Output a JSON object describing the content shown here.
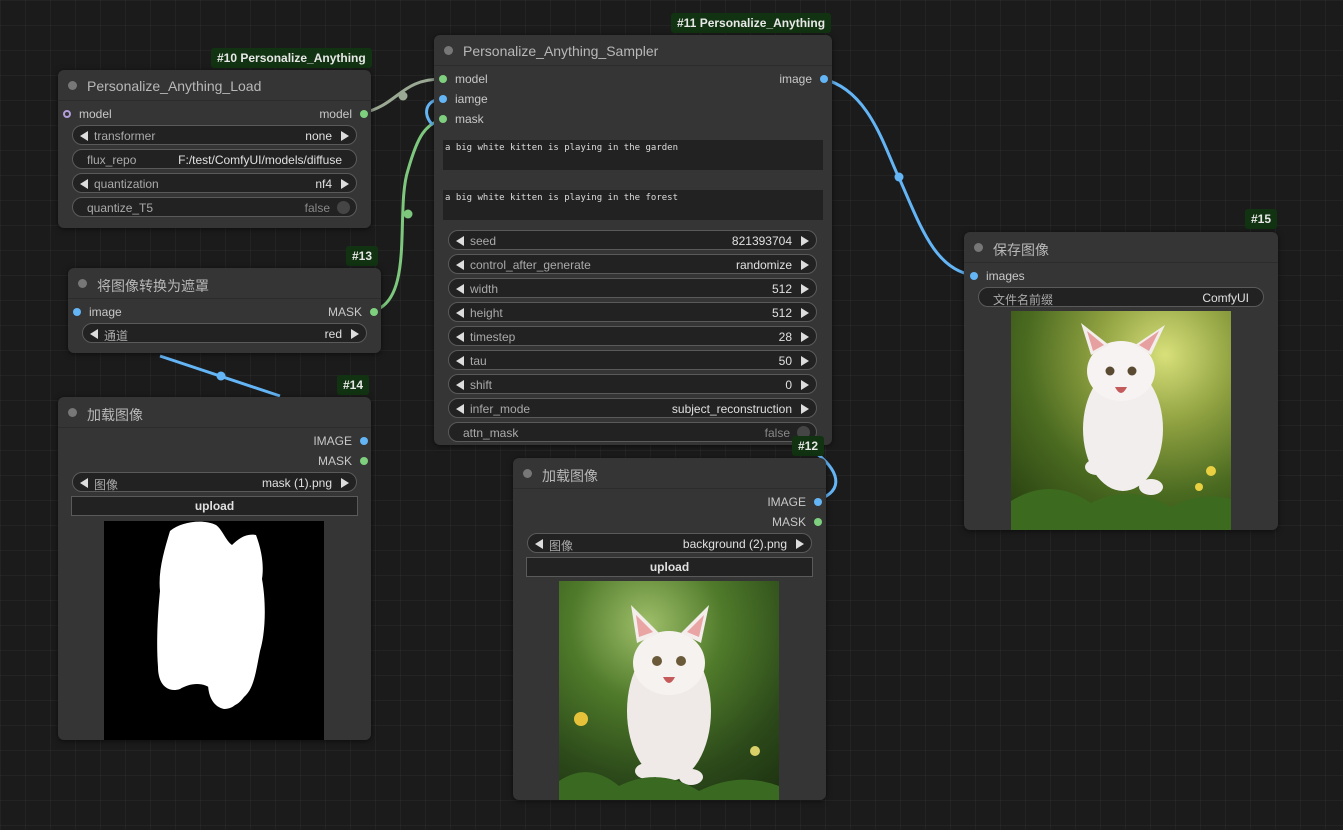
{
  "nodes": {
    "load": {
      "badge": "#10 Personalize_Anything",
      "title": "Personalize_Anything_Load",
      "input": "model",
      "output": "model",
      "widgets": [
        {
          "label": "transformer",
          "value": "none"
        },
        {
          "label": "flux_repo",
          "value": "F:/test/ComfyUI/models/diffuse"
        },
        {
          "label": "quantization",
          "value": "nf4"
        },
        {
          "label": "quantize_T5",
          "value": "false"
        }
      ]
    },
    "mask_convert": {
      "badge": "#13",
      "title": "将图像转换为遮罩",
      "input": "image",
      "output": "MASK",
      "widgets": [
        {
          "label": "通道",
          "value": "red"
        }
      ]
    },
    "load_mask": {
      "badge": "#14",
      "title": "加载图像",
      "outputs": [
        "IMAGE",
        "MASK"
      ],
      "widget": {
        "label": "图像",
        "value": "mask (1).png"
      },
      "upload": "upload"
    },
    "sampler": {
      "badge": "#11 Personalize_Anything",
      "title": "Personalize_Anything_Sampler",
      "inputs": [
        "model",
        "iamge",
        "mask"
      ],
      "output": "image",
      "prompts": [
        "a big white kitten is playing in the garden",
        "a big white kitten is playing in the forest"
      ],
      "widgets": [
        {
          "label": "seed",
          "value": "821393704"
        },
        {
          "label": "control_after_generate",
          "value": "randomize"
        },
        {
          "label": "width",
          "value": "512"
        },
        {
          "label": "height",
          "value": "512"
        },
        {
          "label": "timestep",
          "value": "28"
        },
        {
          "label": "tau",
          "value": "50"
        },
        {
          "label": "shift",
          "value": "0"
        },
        {
          "label": "infer_mode",
          "value": "subject_reconstruction"
        },
        {
          "label": "attn_mask",
          "value": "false"
        }
      ]
    },
    "load_bg": {
      "badge": "#12",
      "title": "加载图像",
      "outputs": [
        "IMAGE",
        "MASK"
      ],
      "widget": {
        "label": "图像",
        "value": "background (2).png"
      },
      "upload": "upload"
    },
    "save": {
      "badge": "#15",
      "title": "保存图像",
      "input": "images",
      "widget": {
        "label": "文件名前缀",
        "value": "ComfyUI"
      }
    }
  },
  "colors": {
    "canvas": "#1b1b1b",
    "node": "#353535",
    "badge_bg": "#113311",
    "link_model": "#aab4a0",
    "link_mask": "#7ec87e",
    "link_image": "#64b5f6"
  }
}
